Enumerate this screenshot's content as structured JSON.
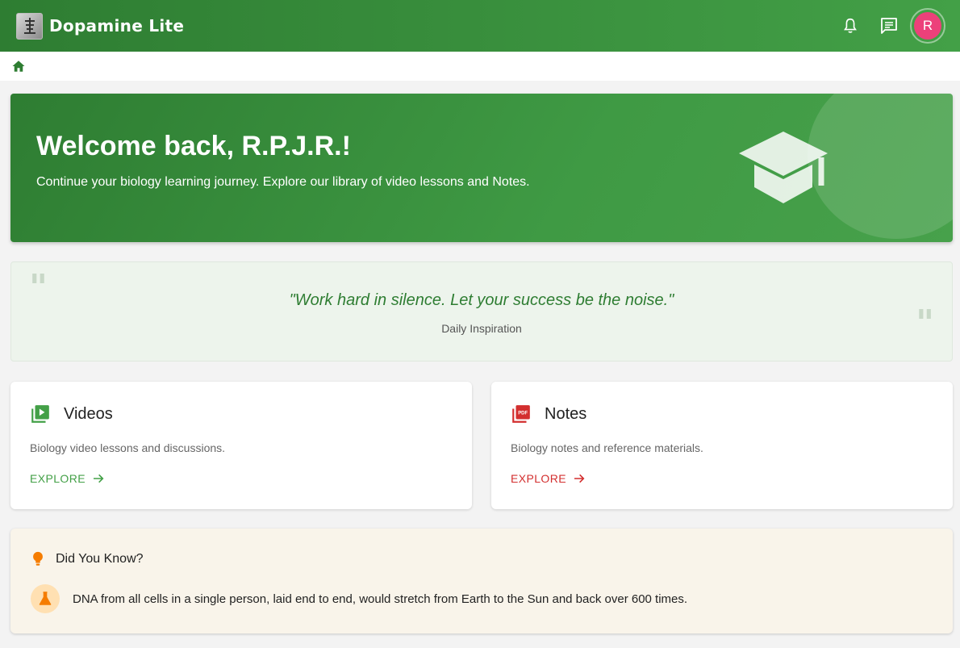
{
  "appbar": {
    "title": "Dopamine Lite",
    "avatar_initial": "R",
    "icons": [
      "bell-icon",
      "message-icon"
    ]
  },
  "breadcrumb": {
    "icon": "home-icon"
  },
  "hero": {
    "title": "Welcome back, R.P.J.R.!",
    "subtitle": "Continue your biology learning journey. Explore our library of video lessons and Notes.",
    "icon": "graduation-cap-icon"
  },
  "quote": {
    "text": "\"Work hard in silence. Let your success be the noise.\"",
    "caption": "Daily Inspiration"
  },
  "cards": {
    "videos": {
      "title": "Videos",
      "description": "Biology video lessons and discussions.",
      "link": "EXPLORE",
      "accent": "#43a047"
    },
    "notes": {
      "title": "Notes",
      "description": "Biology notes and reference materials.",
      "link": "EXPLORE",
      "accent": "#d32f2f"
    }
  },
  "did_you_know": {
    "title": "Did You Know?",
    "fact": "DNA from all cells in a single person, laid end to end, would stretch from Earth to the Sun and back over 600 times."
  },
  "colors": {
    "primary": "#2e7d32",
    "primary_light": "#43a047",
    "avatar": "#ec407a",
    "notes_red": "#d32f2f",
    "fact_orange": "#f57c00"
  }
}
